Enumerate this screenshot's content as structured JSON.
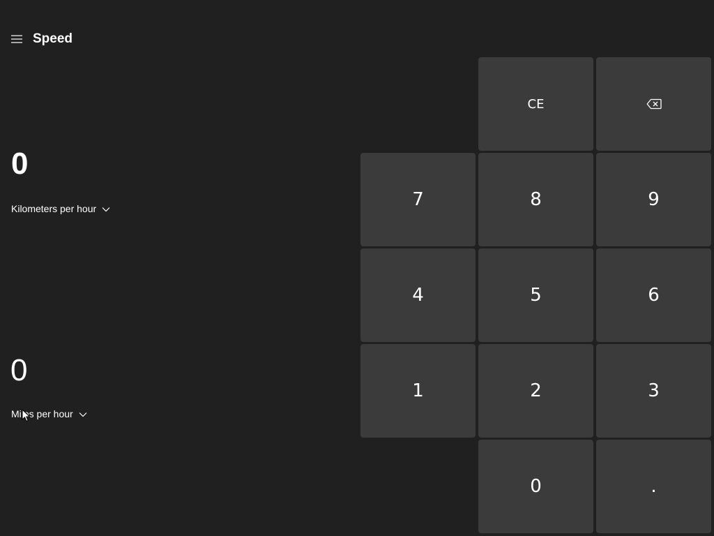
{
  "header": {
    "menu_icon": "hamburger-menu-icon",
    "title": "Speed"
  },
  "converter": {
    "from_value": "0",
    "from_unit": "Kilometers per hour",
    "to_value": "0",
    "to_unit": "Miles per hour",
    "chevron_icon": "chevron-down-icon"
  },
  "keypad": {
    "ce": "CE",
    "backspace_icon": "backspace-icon",
    "k7": "7",
    "k8": "8",
    "k9": "9",
    "k4": "4",
    "k5": "5",
    "k6": "6",
    "k1": "1",
    "k2": "2",
    "k3": "3",
    "k0": "0",
    "decimal": "."
  }
}
